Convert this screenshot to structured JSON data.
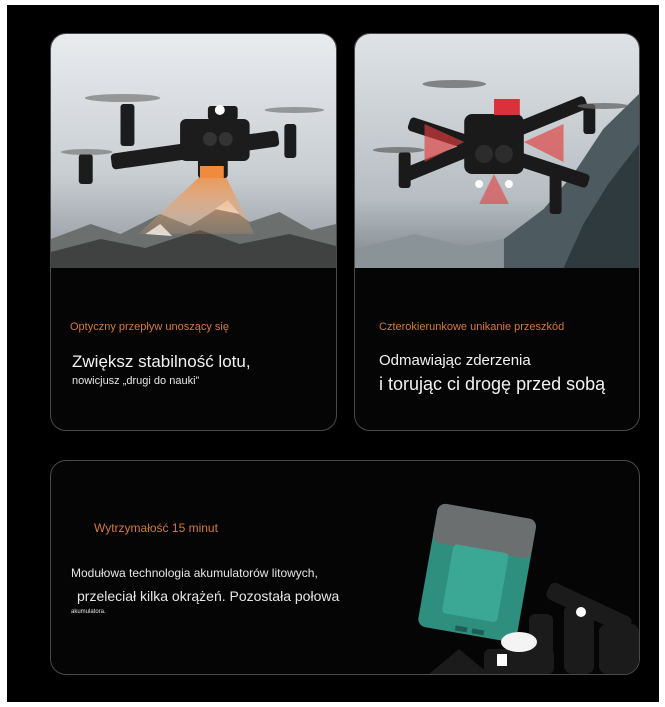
{
  "cards": {
    "left": {
      "title": "Optyczny przepływ unoszący się",
      "headline": "Zwiększ stabilność lotu,",
      "subline": "nowicjusz „drugi do nauki”"
    },
    "right": {
      "title": "Czterokierunkowe unikanie przeszkód",
      "line1": "Odmawiając zderzenia",
      "line2": "i torując ci drogę przed sobą"
    },
    "bottom": {
      "title": "Wytrzymałość 15 minut",
      "line1": "Modułowa technologia akumulatorów litowych,",
      "line2": "przeleciał kilka okrążeń. Pozostała połowa",
      "line3": "akumulatora."
    }
  },
  "colors": {
    "accent": "#d27a3f",
    "background": "#000000",
    "card_border": "#4a4a4a",
    "battery": "#2f8f7f"
  },
  "icons": {
    "left_photo": "drone-optical-flow-photo",
    "right_photo": "drone-obstacle-avoidance-photo",
    "bottom_photo": "drone-battery-photo"
  }
}
